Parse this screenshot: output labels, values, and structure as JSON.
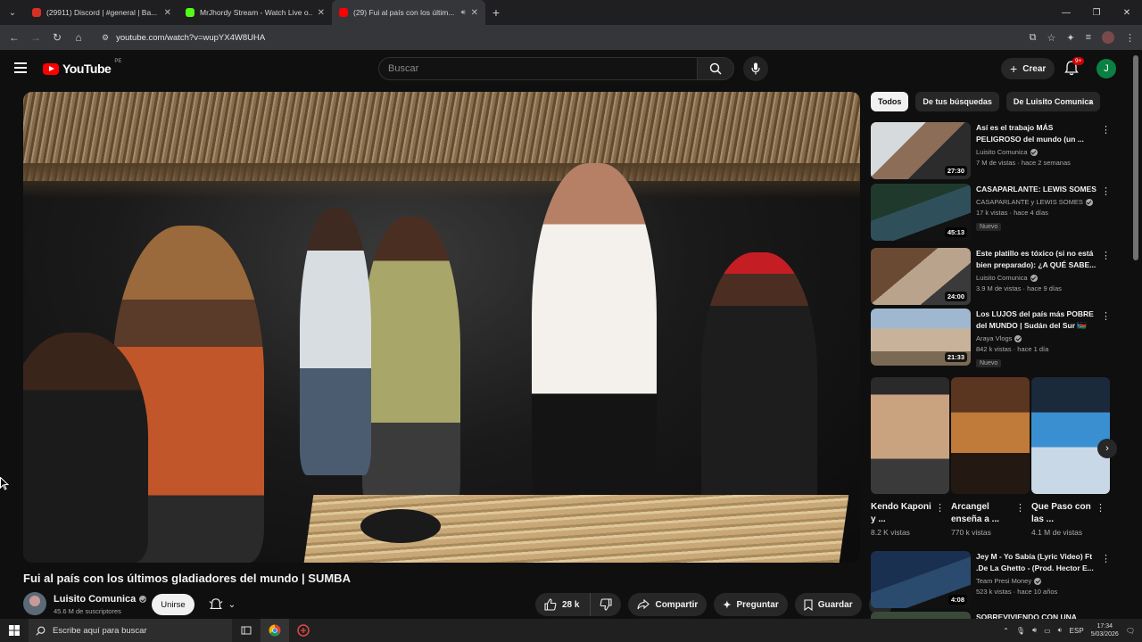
{
  "browser": {
    "tabs": [
      {
        "label": "(29911) Discord | #general | Ba...",
        "color": "#d93025"
      },
      {
        "label": "MrJhordy Stream - Watch Live o...",
        "color": "#53fc18"
      },
      {
        "label": "(29) Fui al país con los últim...",
        "color": "#ff0000"
      }
    ],
    "url": "youtube.com/watch?v=wupYX4W8UHA"
  },
  "header": {
    "logo_text": "YouTube",
    "country_code": "PE",
    "search_placeholder": "Buscar",
    "create_label": "Crear",
    "notifications_badge": "9+",
    "avatar_letter": "J"
  },
  "video": {
    "title": "Fui al país con los últimos gladiadores del mundo | SUMBA",
    "channel": "Luisito Comunica",
    "subscribers": "45.6 M de suscriptores",
    "join_label": "Unirse",
    "likes": "28 k",
    "share_label": "Compartir",
    "ask_label": "Preguntar",
    "save_label": "Guardar"
  },
  "sidebar": {
    "chips": [
      "Todos",
      "De tus búsquedas",
      "De Luisito Comunica"
    ],
    "recommendations": [
      {
        "title": "Así es el trabajo MÁS PELIGROSO del mundo (un ...",
        "channel": "Luisito Comunica",
        "views": "7 M de vistas · hace 2 semanas",
        "duration": "27:30",
        "new": ""
      },
      {
        "title": "CASAPARLANTE: LEWIS SOMES",
        "channel": "CASAPARLANTE  y LEWIS SOMES",
        "views": "17 k vistas · hace 4 días",
        "duration": "45:13",
        "new": "Nuevo"
      },
      {
        "title": "Este platillo es tóxico (si no está bien preparado): ¿A QUÉ SABE...",
        "channel": "Luisito Comunica",
        "views": "3.9 M de vistas · hace 9 días",
        "duration": "24:00",
        "new": ""
      },
      {
        "title": "Los LUJOS del país más POBRE del MUNDO | Sudán del Sur 🇸🇸",
        "channel": "Araya Vlogs",
        "views": "842 k vistas · hace 1 día",
        "duration": "21:33",
        "new": "Nuevo"
      },
      {
        "title": "Jey M - Yo Sabía (Lyric Video) Ft .De La Ghetto - (Prod. Hector E...",
        "channel": "Team Presi Money",
        "views": "523 k vistas · hace 10 años",
        "duration": "4:08",
        "new": ""
      }
    ],
    "shorts": [
      {
        "title": "Kendo Kaponi y ...",
        "views": "8.2 K vistas"
      },
      {
        "title": "Arcangel enseña a ...",
        "views": "770 k vistas"
      },
      {
        "title": "Que Paso con las ...",
        "views": "4.1 M de vistas"
      }
    ],
    "partial_next_title": "SOBREVIVIENDO CON UNA"
  },
  "taskbar": {
    "search_placeholder": "Escribe aquí para buscar",
    "lang": "ESP",
    "time": "17:34",
    "date": "5/03/2026"
  }
}
